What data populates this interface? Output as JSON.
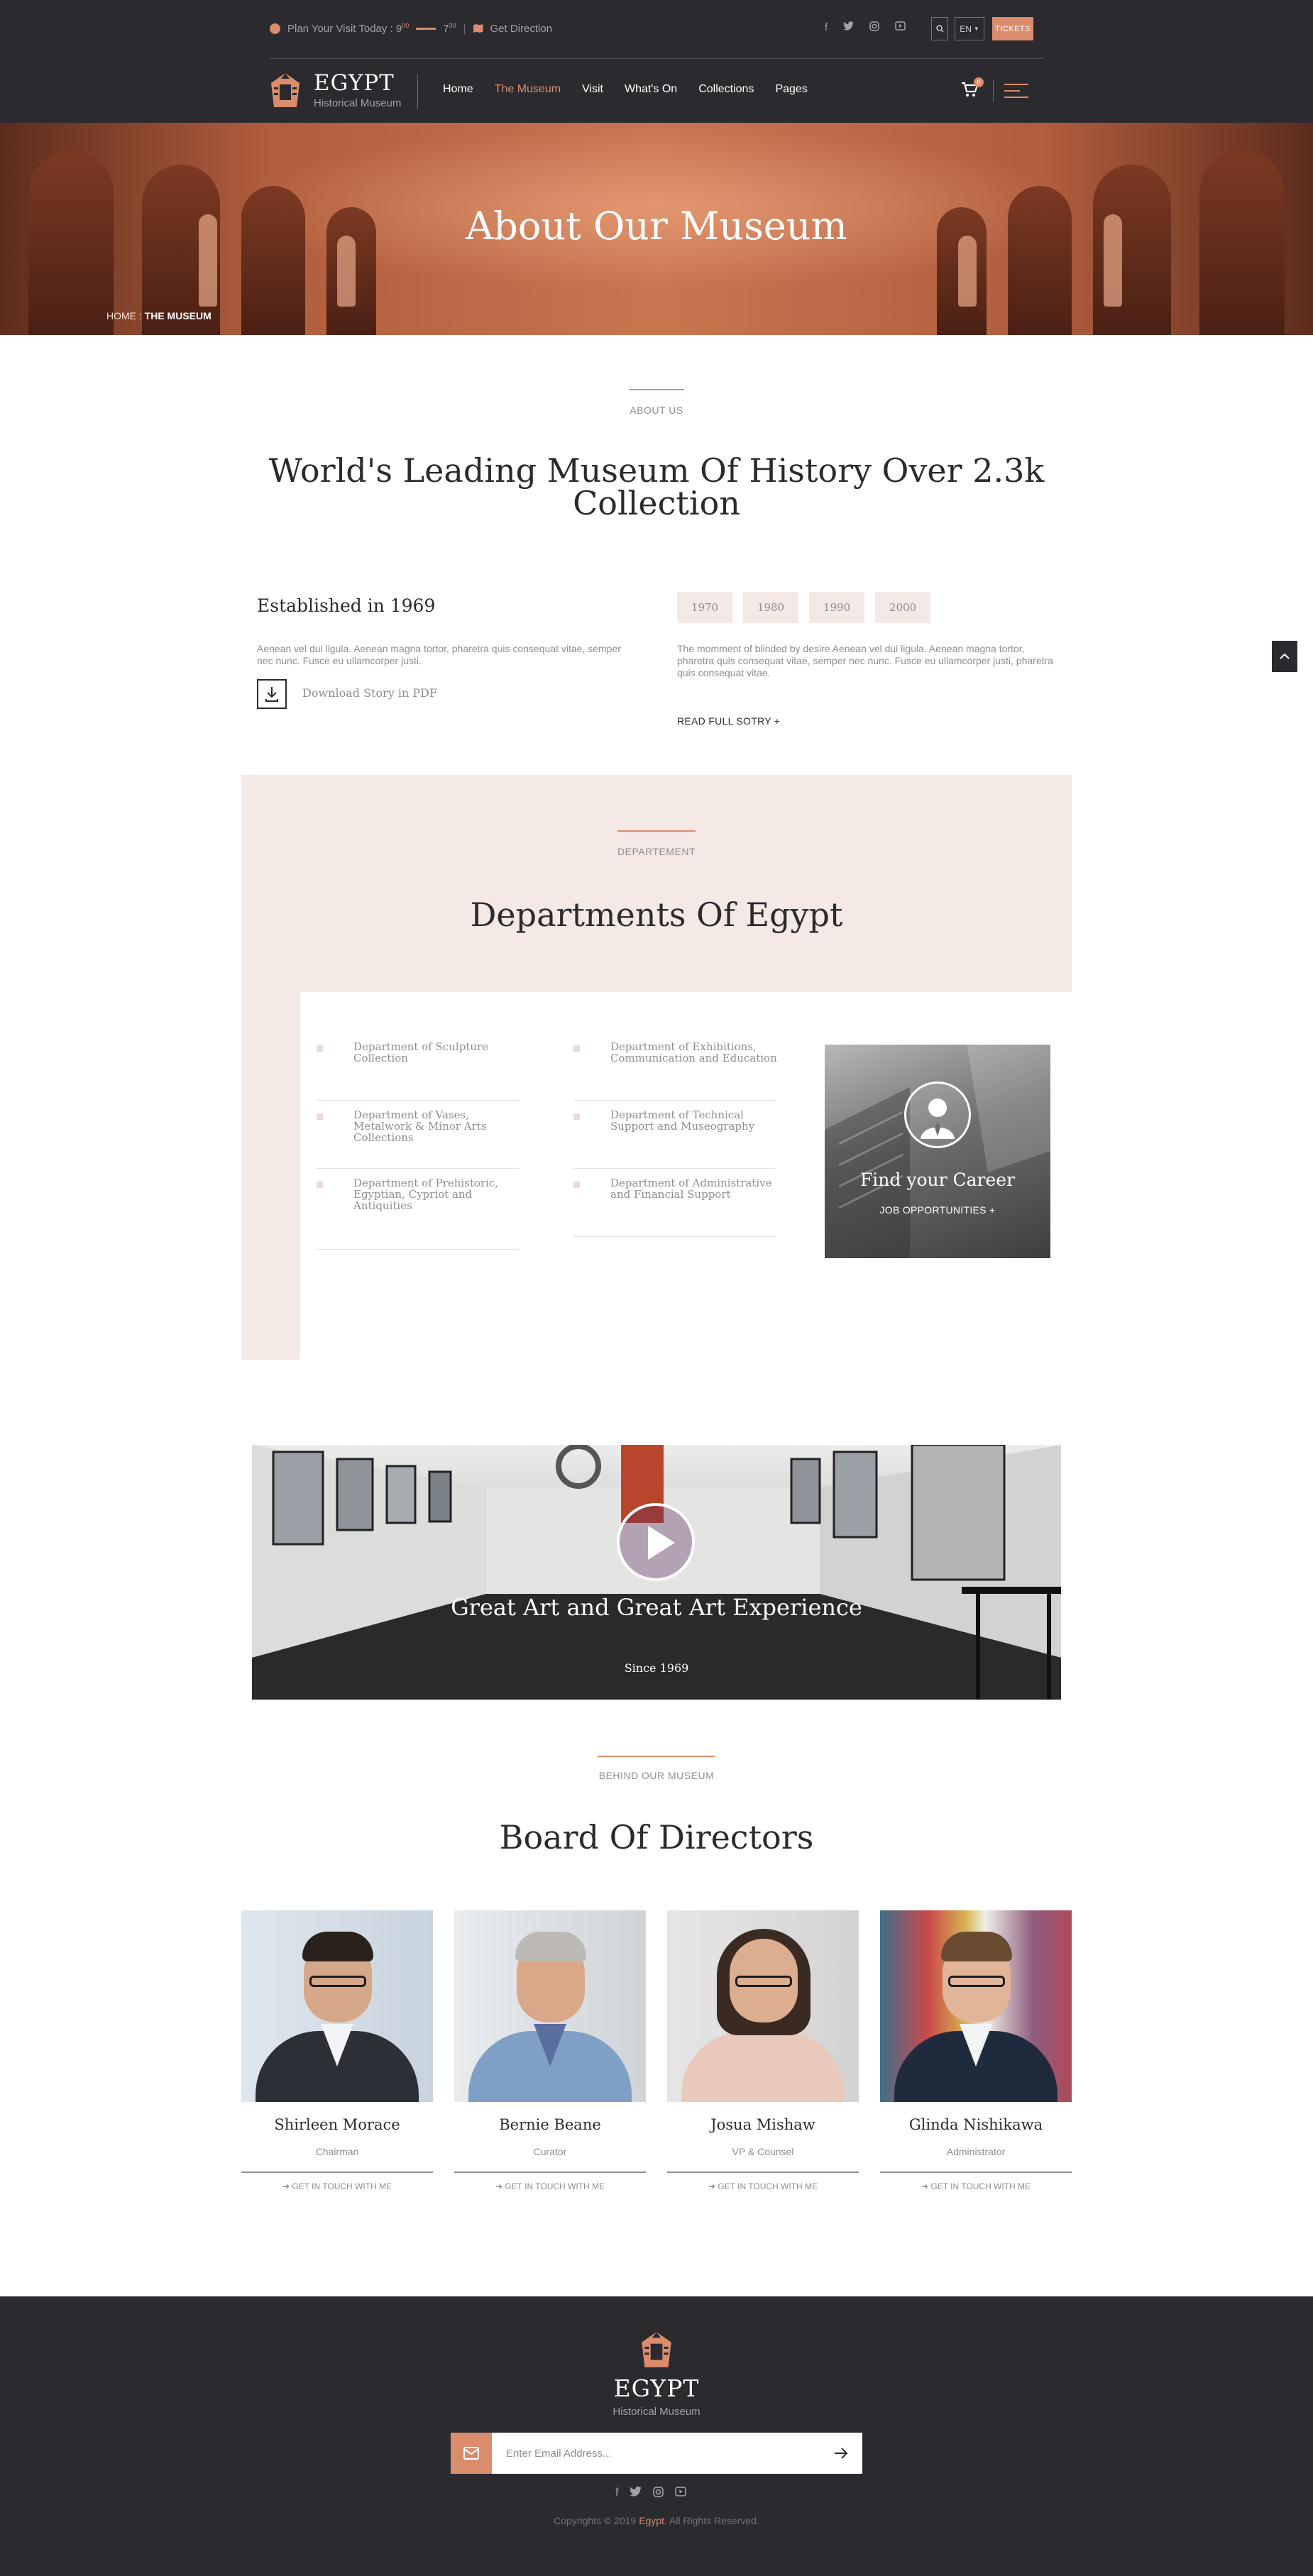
{
  "topbar": {
    "visit_text": "Plan Your Visit Today : 9",
    "open_sup": "00",
    "close_hour": "7",
    "close_sup": "30",
    "direction": "Get Direction",
    "social_icons": [
      "facebook-icon",
      "twitter-icon",
      "instagram-icon",
      "youtube-icon"
    ],
    "language": "EN",
    "tickets": "TICKETS"
  },
  "brand": {
    "title": "EGYPT",
    "subtitle": "Historical Museum"
  },
  "nav": {
    "items": [
      "Home",
      "The Museum",
      "Visit",
      "What's On",
      "Collections",
      "Pages"
    ],
    "active": "The Museum",
    "cart_count": "0"
  },
  "hero": {
    "title": "About Our Museum",
    "crumb_home": "HOME",
    "crumb_sep": " : ",
    "crumb_current": "THE MUSEUM"
  },
  "about": {
    "eyebrow": "ABOUT US",
    "heading_line1": "World's Leading Museum Of History Over 2.3k",
    "heading_line2": "Collection",
    "established": "Established in 1969",
    "intro": "Aenean vel dui ligula. Aenean magna tortor, pharetra quis consequat vitae, semper nec nunc. Fusce eu ullamcorper justi.",
    "download": "Download Story in PDF",
    "years": [
      "1970",
      "1980",
      "1990",
      "2000"
    ],
    "story": "The momment of blinded by desire Aenean vel dui ligula. Aenean magna tortor, pharetra quis consequat vitae, semper nec nunc. Fusce eu ullamcorper justi, pharetra quis consequat vitae.",
    "read_more": "READ FULL SOTRY +"
  },
  "departments": {
    "eyebrow": "DEPARTEMENT",
    "heading": "Departments Of Egypt",
    "column1": [
      "Department of Sculpture Collection",
      "Department of Vases, Metalwork & Minor Arts Collections",
      "Department of Prehistoric, Egyptian, Cypriot and Antiquities"
    ],
    "column2": [
      "Department of Exhibitions, Communication and Education",
      "Department of Technical Support and Museography",
      "Department of Administrative and Financial Support"
    ],
    "career_title": "Find your Career",
    "career_link": "JOB OPPORTUNITIES +"
  },
  "video": {
    "title": "Great Art and Great Art Experience",
    "since": "Since 1969"
  },
  "board": {
    "eyebrow": "BEHIND OUR MUSEUM",
    "heading": "Board Of Directors",
    "contact_label": "GET IN TOUCH WITH ME",
    "members": [
      {
        "name": "Shirleen Morace",
        "role": "Chairman"
      },
      {
        "name": "Bernie Beane",
        "role": "Curator"
      },
      {
        "name": "Josua Mishaw",
        "role": "VP & Counsel"
      },
      {
        "name": "Glinda Nishikawa",
        "role": "Administrator"
      }
    ]
  },
  "footer": {
    "title": "EGYPT",
    "subtitle": "Historical Museum",
    "email_placeholder": "Enter Email Address...",
    "copy_prefix": "Copyrights © 2019 ",
    "copy_brand": "Egypt",
    "copy_suffix": ". All Rights Reserved."
  },
  "colors": {
    "accent": "#d98d6d",
    "dark": "#2b2a2e",
    "blush": "#f4e9e5",
    "muted": "#8f8c93"
  }
}
